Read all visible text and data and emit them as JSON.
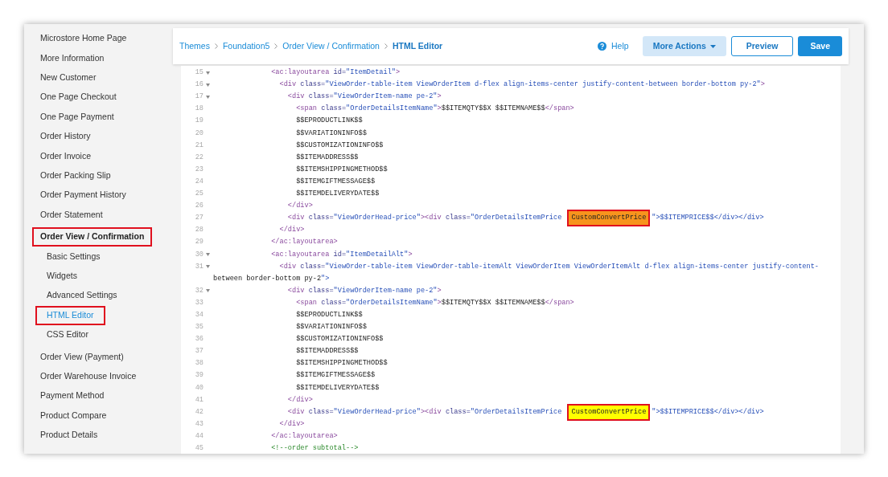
{
  "sidebar": {
    "items": [
      {
        "label": "Microstore Home Page",
        "selected": false,
        "expanded": false,
        "annotated": false
      },
      {
        "label": "More Information",
        "selected": false,
        "expanded": false,
        "annotated": false
      },
      {
        "label": "New Customer",
        "selected": false,
        "expanded": false,
        "annotated": false
      },
      {
        "label": "One Page Checkout",
        "selected": false,
        "expanded": false,
        "annotated": false
      },
      {
        "label": "One Page Payment",
        "selected": false,
        "expanded": false,
        "annotated": false
      },
      {
        "label": "Order History",
        "selected": false,
        "expanded": false,
        "annotated": false
      },
      {
        "label": "Order Invoice",
        "selected": false,
        "expanded": false,
        "annotated": false
      },
      {
        "label": "Order Packing Slip",
        "selected": false,
        "expanded": false,
        "annotated": false
      },
      {
        "label": "Order Payment History",
        "selected": false,
        "expanded": false,
        "annotated": false
      },
      {
        "label": "Order Statement",
        "selected": false,
        "expanded": false,
        "annotated": false
      },
      {
        "label": "Order View / Confirmation",
        "selected": false,
        "expanded": true,
        "annotated": true,
        "children": [
          {
            "label": "Basic Settings",
            "selected": false,
            "annotated": false
          },
          {
            "label": "Widgets",
            "selected": false,
            "annotated": false
          },
          {
            "label": "Advanced Settings",
            "selected": false,
            "annotated": false
          },
          {
            "label": "HTML Editor",
            "selected": true,
            "annotated": true
          },
          {
            "label": "CSS Editor",
            "selected": false,
            "annotated": false
          }
        ]
      },
      {
        "label": "Order View (Payment)",
        "selected": false,
        "expanded": false,
        "annotated": false
      },
      {
        "label": "Order Warehouse Invoice",
        "selected": false,
        "expanded": false,
        "annotated": false
      },
      {
        "label": "Payment Method",
        "selected": false,
        "expanded": false,
        "annotated": false
      },
      {
        "label": "Product Compare",
        "selected": false,
        "expanded": false,
        "annotated": false
      },
      {
        "label": "Product Details",
        "selected": false,
        "expanded": false,
        "annotated": false
      }
    ]
  },
  "breadcrumbs": [
    {
      "label": "Themes",
      "current": false
    },
    {
      "label": "Foundation5",
      "current": false
    },
    {
      "label": "Order View / Confirmation",
      "current": false
    },
    {
      "label": "HTML Editor",
      "current": true
    }
  ],
  "toolbar": {
    "help": "Help",
    "more_actions": "More Actions",
    "preview": "Preview",
    "save": "Save"
  },
  "editor": {
    "lines": [
      {
        "number": "15",
        "fold": true,
        "parts": [
          {
            "text": "              <ac:layoutarea id=\"ItemDetail\">"
          }
        ]
      },
      {
        "number": "16",
        "fold": true,
        "parts": [
          {
            "text": "                <div class=\"ViewOrder-table-item ViewOrderItem d-flex align-items-center justify-content-between border-bottom py-2\">"
          }
        ]
      },
      {
        "number": "17",
        "fold": true,
        "parts": [
          {
            "text": "                  <div class=\"ViewOrderItem-name pe-2\">"
          }
        ]
      },
      {
        "number": "18",
        "fold": false,
        "parts": [
          {
            "text": "                    <span class=\"OrderDetailsItemName\">$$ITEMQTY$$X $$ITEMNAME$$</span>"
          }
        ]
      },
      {
        "number": "19",
        "fold": false,
        "parts": [
          {
            "text": "                    $$EPRODUCTLINK$$"
          }
        ]
      },
      {
        "number": "20",
        "fold": false,
        "parts": [
          {
            "text": "                    $$VARIATIONINFO$$"
          }
        ]
      },
      {
        "number": "21",
        "fold": false,
        "parts": [
          {
            "text": "                    $$CUSTOMIZATIONINFO$$"
          }
        ]
      },
      {
        "number": "22",
        "fold": false,
        "parts": [
          {
            "text": "                    $$ITEMADDRESS$$"
          }
        ]
      },
      {
        "number": "23",
        "fold": false,
        "parts": [
          {
            "text": "                    $$ITEMSHIPPINGMETHOD$$"
          }
        ]
      },
      {
        "number": "24",
        "fold": false,
        "parts": [
          {
            "text": "                    $$ITEMGIFTMESSAGE$$"
          }
        ]
      },
      {
        "number": "25",
        "fold": false,
        "parts": [
          {
            "text": "                    $$ITEMDELIVERYDATE$$"
          }
        ]
      },
      {
        "number": "26",
        "fold": false,
        "parts": [
          {
            "text": "                  </div>"
          }
        ]
      },
      {
        "number": "27",
        "fold": false,
        "parts": [
          {
            "text": "                  <div class=\"ViewOrderHead-price\"><div class=\"OrderDetailsItemPrice "
          },
          {
            "text": "CustomConvertPrice",
            "color": "#f7941d",
            "boxed": true
          },
          {
            "text": "\">$$ITEMPRICE$$</div></div>"
          }
        ]
      },
      {
        "number": "28",
        "fold": false,
        "parts": [
          {
            "text": "                </div>"
          }
        ]
      },
      {
        "number": "29",
        "fold": false,
        "parts": [
          {
            "text": "              </ac:layoutarea>"
          }
        ]
      },
      {
        "number": "30",
        "fold": true,
        "parts": [
          {
            "text": "              <ac:layoutarea id=\"ItemDetailAlt\">"
          }
        ]
      },
      {
        "number": "31",
        "fold": true,
        "parts": [
          {
            "text": "                <div class=\"ViewOrder-table-item ViewOrder-table-itemAlt ViewOrderItem ViewOrderItemAlt d-flex align-items-center justify-content-"
          }
        ],
        "continued": "between border-bottom py-2\">"
      },
      {
        "number": "32",
        "fold": true,
        "parts": [
          {
            "text": "                  <div class=\"ViewOrderItem-name pe-2\">"
          }
        ]
      },
      {
        "number": "33",
        "fold": false,
        "parts": [
          {
            "text": "                    <span class=\"OrderDetailsItemName\">$$ITEMQTY$$X $$ITEMNAME$$</span>"
          }
        ]
      },
      {
        "number": "34",
        "fold": false,
        "parts": [
          {
            "text": "                    $$EPRODUCTLINK$$"
          }
        ]
      },
      {
        "number": "35",
        "fold": false,
        "parts": [
          {
            "text": "                    $$VARIATIONINFO$$"
          }
        ]
      },
      {
        "number": "36",
        "fold": false,
        "parts": [
          {
            "text": "                    $$CUSTOMIZATIONINFO$$"
          }
        ]
      },
      {
        "number": "37",
        "fold": false,
        "parts": [
          {
            "text": "                    $$ITEMADDRESS$$"
          }
        ]
      },
      {
        "number": "38",
        "fold": false,
        "parts": [
          {
            "text": "                    $$ITEMSHIPPINGMETHOD$$"
          }
        ]
      },
      {
        "number": "39",
        "fold": false,
        "parts": [
          {
            "text": "                    $$ITEMGIFTMESSAGE$$"
          }
        ]
      },
      {
        "number": "40",
        "fold": false,
        "parts": [
          {
            "text": "                    $$ITEMDELIVERYDATE$$"
          }
        ]
      },
      {
        "number": "41",
        "fold": false,
        "parts": [
          {
            "text": "                  </div>"
          }
        ]
      },
      {
        "number": "42",
        "fold": false,
        "parts": [
          {
            "text": "                  <div class=\"ViewOrderHead-price\"><div class=\"OrderDetailsItemPrice "
          },
          {
            "text": "CustomConvertPrice",
            "color": "#ffff00",
            "boxed": true
          },
          {
            "text": "\">$$ITEMPRICE$$</div></div>"
          }
        ]
      },
      {
        "number": "43",
        "fold": false,
        "parts": [
          {
            "text": "                </div>"
          }
        ]
      },
      {
        "number": "44",
        "fold": false,
        "parts": [
          {
            "text": "              </ac:layoutarea>"
          }
        ]
      },
      {
        "number": "45",
        "fold": false,
        "parts": [
          {
            "text": "              <!--order subtotal-->"
          }
        ]
      }
    ]
  }
}
